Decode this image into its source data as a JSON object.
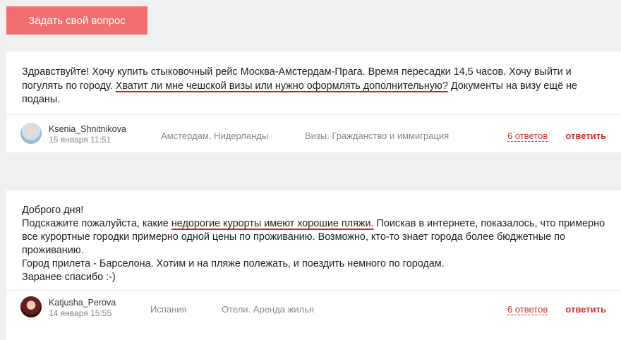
{
  "ask_button": "Задать свой вопрос",
  "questions": [
    {
      "text_before": "Здравствуйте! Хочу купить стыковочный рейс Москва-Амстердам-Прага. Время пересадки 14,5 часов. Хочу выйти и погулять по городу. ",
      "highlight": "Хватит ли мне чешской визы или нужно оформлять дополнительную?",
      "text_after": " Документы на визу ещё не поданы.",
      "author": "Ksenia_Shnitnikova",
      "date": "15 января 11:51",
      "location": "Амстердам, Нидерланды",
      "category": "Визы. Гражданство и иммиграция",
      "answers": "6 ответов",
      "reply": "ответить"
    },
    {
      "line1": "Доброго дня!",
      "text_before": "Подскажите пожалуйста, какие ",
      "highlight": "недорогие курорты имеют хорошие пляжи.",
      "text_after": " Поискав в интернете, показалось, что примерно все курортные городки примерно одной цены по проживанию. Возможно, кто-то знает города более бюджетные по проживанию.",
      "line3": "Город прилета - Барселона. Хотим и на пляже полежать, и поездить немного по городам.",
      "line4": "Заранее спасибо :-)",
      "author": "Katjusha_Perova",
      "date": "14 января 15:55",
      "location": "Испания",
      "category": "Отели. Аренда жилья",
      "answers": "6 ответов",
      "reply": "ответить"
    }
  ]
}
